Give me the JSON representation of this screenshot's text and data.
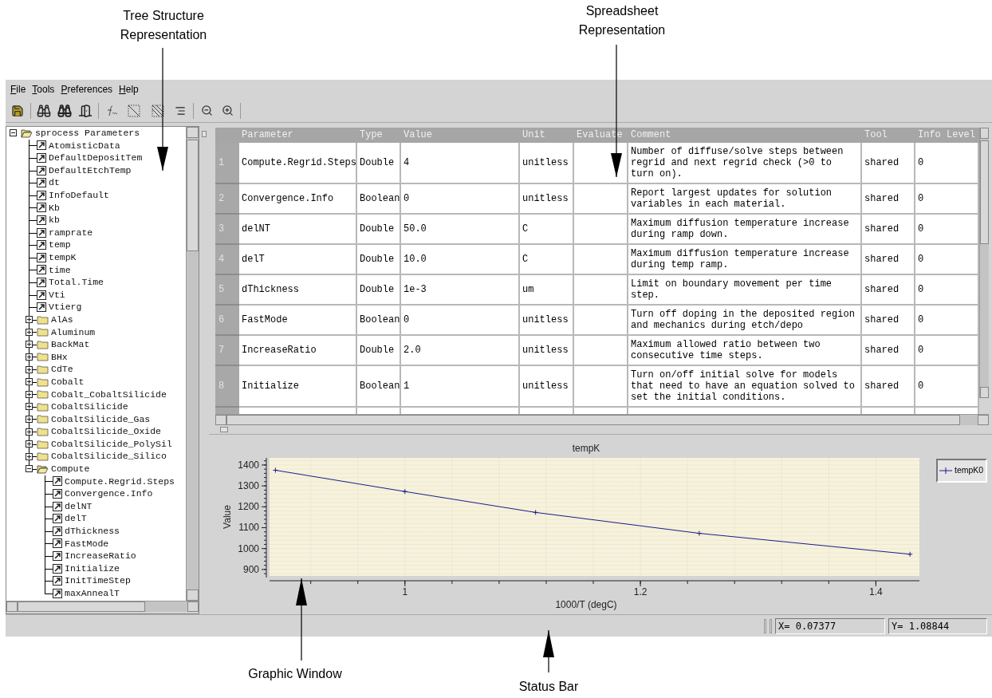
{
  "callouts": [
    {
      "text": "Tree Structure Representation"
    },
    {
      "text": "Spreadsheet Representation"
    },
    {
      "text": "Graphic Window"
    },
    {
      "text": "Status Bar"
    }
  ],
  "menu": [
    "File",
    "Tools",
    "Preferences",
    "Help"
  ],
  "tree": {
    "label": "sprocess Parameters",
    "kind": "folder",
    "expanded": true,
    "children": [
      {
        "label": "AtomisticData",
        "kind": "param"
      },
      {
        "label": "DefaultDepositTem",
        "kind": "param"
      },
      {
        "label": "DefaultEtchTemp",
        "kind": "param"
      },
      {
        "label": "dt",
        "kind": "param"
      },
      {
        "label": "InfoDefault",
        "kind": "param"
      },
      {
        "label": "Kb",
        "kind": "param"
      },
      {
        "label": "kb",
        "kind": "param"
      },
      {
        "label": "ramprate",
        "kind": "param"
      },
      {
        "label": "temp",
        "kind": "param"
      },
      {
        "label": "tempK",
        "kind": "param"
      },
      {
        "label": "time",
        "kind": "param"
      },
      {
        "label": "Total.Time",
        "kind": "param"
      },
      {
        "label": "Vti",
        "kind": "param"
      },
      {
        "label": "Vtierg",
        "kind": "param"
      },
      {
        "label": "AlAs",
        "kind": "folder",
        "expanded": false
      },
      {
        "label": "Aluminum",
        "kind": "folder",
        "expanded": false
      },
      {
        "label": "BackMat",
        "kind": "folder",
        "expanded": false
      },
      {
        "label": "BHx",
        "kind": "folder",
        "expanded": false
      },
      {
        "label": "CdTe",
        "kind": "folder",
        "expanded": false
      },
      {
        "label": "Cobalt",
        "kind": "folder",
        "expanded": false
      },
      {
        "label": "Cobalt_CobaltSilicide",
        "kind": "folder",
        "expanded": false
      },
      {
        "label": "CobaltSilicide",
        "kind": "folder",
        "expanded": false
      },
      {
        "label": "CobaltSilicide_Gas",
        "kind": "folder",
        "expanded": false
      },
      {
        "label": "CobaltSilicide_Oxide",
        "kind": "folder",
        "expanded": false
      },
      {
        "label": "CobaltSilicide_PolySil",
        "kind": "folder",
        "expanded": false
      },
      {
        "label": "CobaltSilicide_Silico",
        "kind": "folder",
        "expanded": false
      },
      {
        "label": "Compute",
        "kind": "folder",
        "expanded": true,
        "children": [
          {
            "label": "Compute.Regrid.Steps",
            "kind": "param"
          },
          {
            "label": "Convergence.Info",
            "kind": "param"
          },
          {
            "label": "delNT",
            "kind": "param"
          },
          {
            "label": "delT",
            "kind": "param"
          },
          {
            "label": "dThickness",
            "kind": "param"
          },
          {
            "label": "FastMode",
            "kind": "param"
          },
          {
            "label": "IncreaseRatio",
            "kind": "param"
          },
          {
            "label": "Initialize",
            "kind": "param"
          },
          {
            "label": "InitTimeStep",
            "kind": "param"
          },
          {
            "label": "maxAnnealT",
            "kind": "param"
          }
        ]
      }
    ]
  },
  "table": {
    "columns": [
      "Parameter",
      "Type",
      "Value",
      "Unit",
      "Evaluate",
      "Comment",
      "Tool",
      "Info Level"
    ],
    "rows": [
      {
        "number": "1",
        "parameter": "Compute.Regrid.Steps",
        "type": "Double",
        "value": "4",
        "unit": "unitless",
        "comment": "Number of diffuse/solve steps between regrid and next regrid check (>0 to turn on).",
        "tool": "shared",
        "info_level": "0"
      },
      {
        "number": "2",
        "parameter": "Convergence.Info",
        "type": "Boolean",
        "value": "0",
        "unit": "unitless",
        "comment": "Report largest updates for solution variables in each material.",
        "tool": "shared",
        "info_level": "0"
      },
      {
        "number": "3",
        "parameter": "delNT",
        "type": "Double",
        "value": "50.0",
        "unit": "C",
        "comment": "Maximum diffusion temperature increase during ramp down.",
        "tool": "shared",
        "info_level": "0"
      },
      {
        "number": "4",
        "parameter": "delT",
        "type": "Double",
        "value": "10.0",
        "unit": "C",
        "comment": "Maximum diffusion temperature increase during temp ramp.",
        "tool": "shared",
        "info_level": "0"
      },
      {
        "number": "5",
        "parameter": "dThickness",
        "type": "Double",
        "value": "1e-3",
        "unit": "um",
        "comment": "Limit on boundary movement per time step.",
        "tool": "shared",
        "info_level": "0"
      },
      {
        "number": "6",
        "parameter": "FastMode",
        "type": "Boolean",
        "value": "0",
        "unit": "unitless",
        "comment": "Turn off doping in the deposited region and mechanics during etch/depo",
        "tool": "shared",
        "info_level": "0"
      },
      {
        "number": "7",
        "parameter": "IncreaseRatio",
        "type": "Double",
        "value": "2.0",
        "unit": "unitless",
        "comment": "Maximum allowed ratio between two consecutive time steps.",
        "tool": "shared",
        "info_level": "0"
      },
      {
        "number": "8",
        "parameter": "Initialize",
        "type": "Boolean",
        "value": "1",
        "unit": "unitless",
        "comment": "Turn on/off initial solve for models that need to have an equation solved to set the initial conditions.",
        "tool": "shared",
        "info_level": "0"
      }
    ]
  },
  "graph": {
    "chart_data": {
      "type": "line",
      "title": "tempK",
      "xlabel": "1000/T (degC)",
      "ylabel": "Value",
      "x": [
        0.89,
        1.0,
        1.111,
        1.25,
        1.429
      ],
      "series": [
        {
          "name": "tempK0",
          "color": "#1c1c8a",
          "marker": "+",
          "values": [
            1375,
            1273,
            1173,
            1073,
            973
          ]
        }
      ],
      "grid": true,
      "xlim": [
        0.885,
        1.437
      ],
      "ylim": [
        869,
        1434
      ],
      "xticks": [
        {
          "value": 1,
          "label": "1"
        },
        {
          "value": 1.2,
          "label": "1.2"
        },
        {
          "value": 1.4,
          "label": "1.4"
        }
      ],
      "yticks": [
        900,
        1000,
        1100,
        1200,
        1300,
        1400
      ]
    }
  },
  "status_bar": {
    "x_readout": "X= 0.07377",
    "y_readout": "Y= 1.08844"
  }
}
